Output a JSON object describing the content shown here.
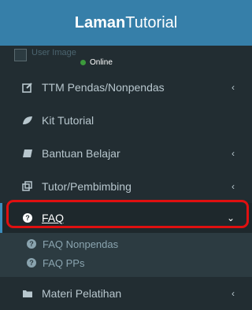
{
  "header": {
    "brand_bold": "Laman",
    "brand_light": "Tutorial"
  },
  "user": {
    "avatar_alt": "User Image",
    "status": "Online"
  },
  "menu": [
    {
      "label": "TTM Pendas/Nonpendas",
      "icon": "edit-icon"
    },
    {
      "label": "Kit Tutorial",
      "icon": "leaf-icon"
    },
    {
      "label": "Bantuan Belajar",
      "icon": "book-icon"
    },
    {
      "label": "Tutor/Pembimbing",
      "icon": "copy-icon"
    },
    {
      "label": "FAQ",
      "icon": "question-circle-icon"
    },
    {
      "label": "Materi Pelatihan",
      "icon": "folder-icon"
    }
  ],
  "faq_submenu": [
    {
      "label": "FAQ Nonpendas",
      "icon": "question-circle-icon"
    },
    {
      "label": "FAQ PPs",
      "icon": "question-circle-icon"
    }
  ],
  "colors": {
    "header_bg": "#367fa9",
    "sidebar_bg": "#222d32",
    "active_bg": "#1e282c",
    "highlight": "#e01010",
    "online": "#3c9a3c"
  }
}
